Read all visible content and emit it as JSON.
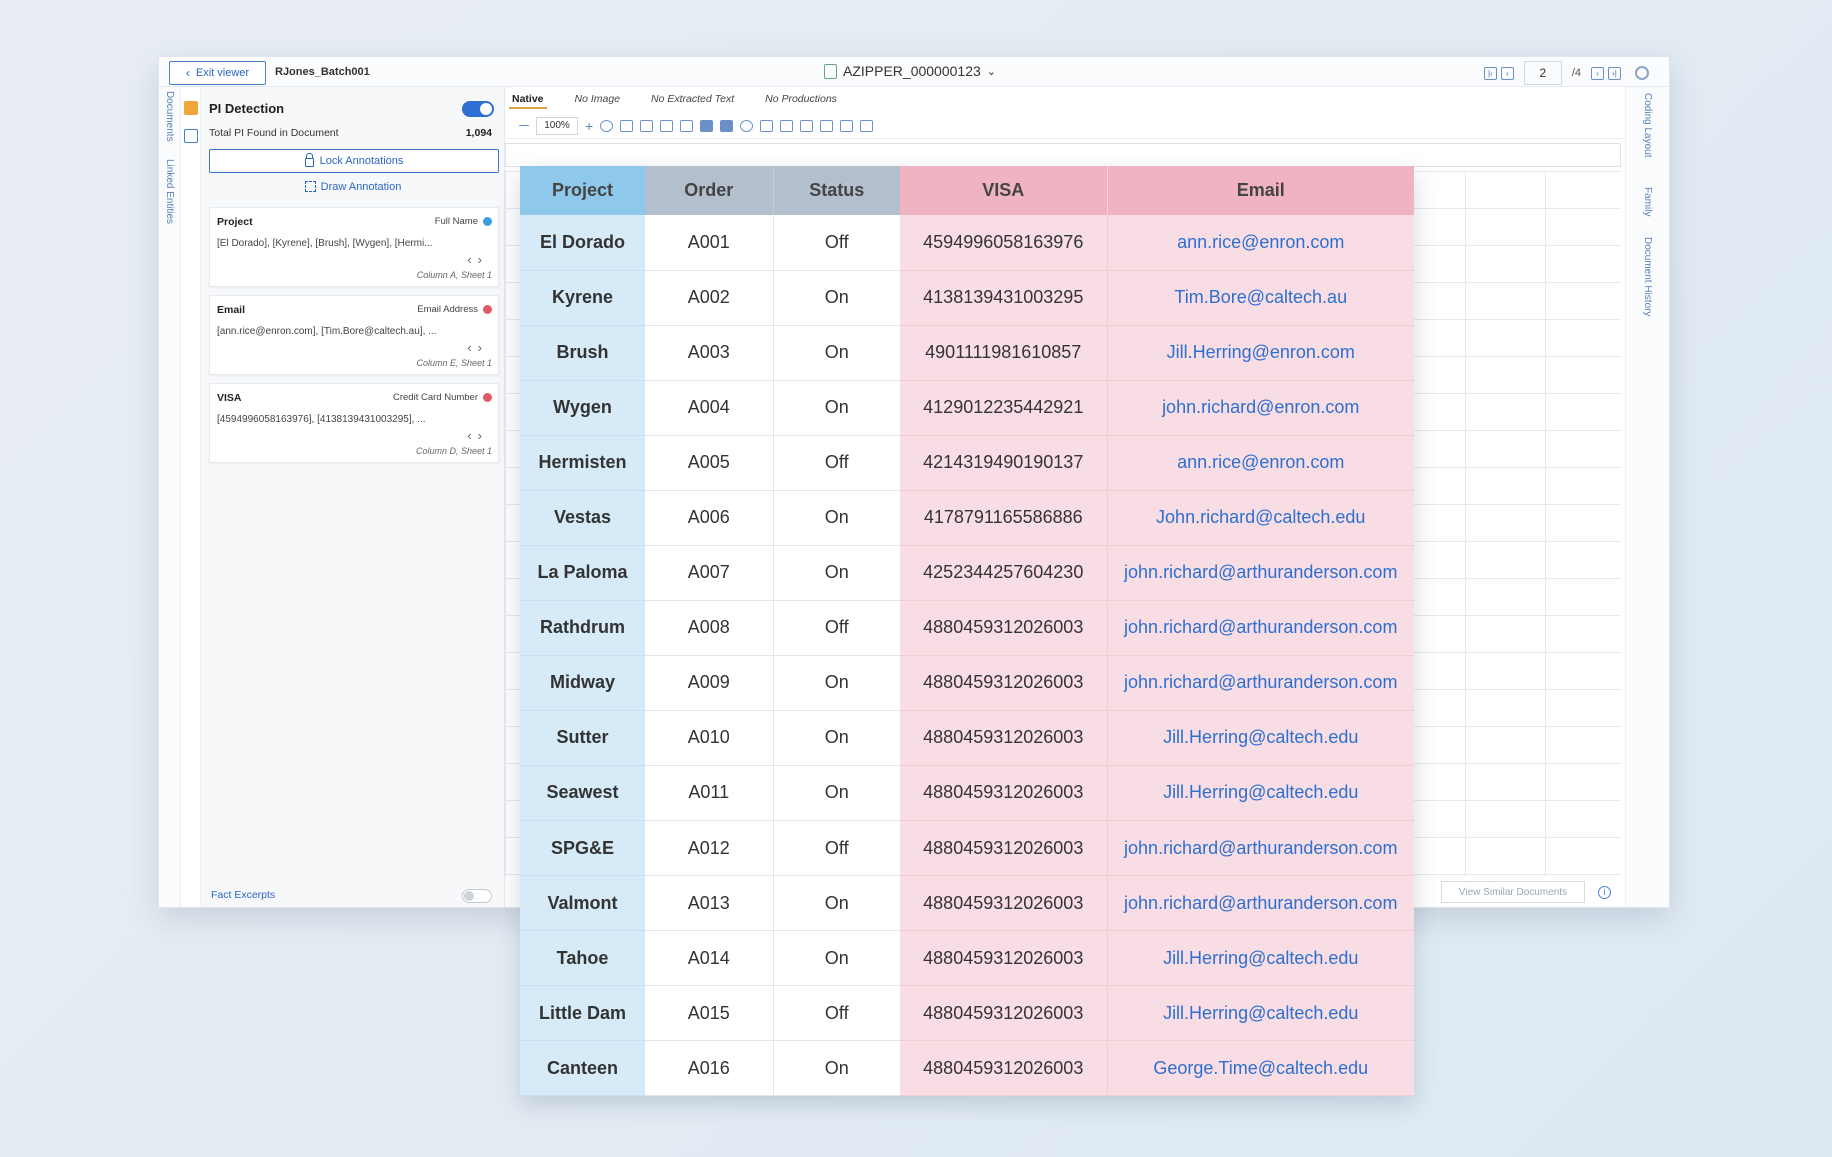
{
  "topbar": {
    "exit_label": "Exit viewer",
    "batch_name": "RJones_Batch001",
    "doc_title": "AZIPPER_000000123",
    "page_current": "2",
    "page_total": "/4"
  },
  "left_rail": {
    "documents": "Documents",
    "linked_entities": "Linked Entities"
  },
  "pi_panel": {
    "title": "PI Detection",
    "enabled": true,
    "total_label": "Total PI Found in Document",
    "total_value": "1,094",
    "lock_label": "Lock Annotations",
    "draw_label": "Draw Annotation",
    "cards": [
      {
        "title": "Project",
        "type": "Full Name",
        "color": "#3d9be0",
        "values": "[El Dorado], [Kyrene], [Brush], [Wygen], [Hermi...",
        "location": "Column A, Sheet 1"
      },
      {
        "title": "Email",
        "type": "Email Address",
        "color": "#e05a6a",
        "values": "[ann.rice@enron.com], [Tim.Bore@caltech.au], ...",
        "location": "Column E, Sheet 1"
      },
      {
        "title": "VISA",
        "type": "Credit Card Number",
        "color": "#e05a6a",
        "values": "[4594996058163976], [4138139431003295], ...",
        "location": "Column D, Sheet 1"
      }
    ],
    "fact_excerpts_label": "Fact Excerpts",
    "fact_excerpts_enabled": false
  },
  "viewer": {
    "tabs": [
      "Native",
      "No Image",
      "No Extracted Text",
      "No Productions"
    ],
    "active_tab": "Native",
    "zoom": "100%",
    "similar_label": "View Similar Documents"
  },
  "right_rail": {
    "coding_layout": "Coding Layout",
    "family": "Family",
    "document_history": "Document History"
  },
  "table": {
    "headers": {
      "project": "Project",
      "order": "Order",
      "status": "Status",
      "visa": "VISA",
      "email": "Email"
    },
    "rows": [
      {
        "project": "El Dorado",
        "order": "A001",
        "status": "Off",
        "visa": "4594996058163976",
        "email": "ann.rice@enron.com"
      },
      {
        "project": "Kyrene",
        "order": "A002",
        "status": "On",
        "visa": "4138139431003295",
        "email": "Tim.Bore@caltech.au"
      },
      {
        "project": "Brush",
        "order": "A003",
        "status": "On",
        "visa": "4901111981610857",
        "email": "Jill.Herring@enron.com"
      },
      {
        "project": "Wygen",
        "order": "A004",
        "status": "On",
        "visa": "4129012235442921",
        "email": "john.richard@enron.com"
      },
      {
        "project": "Hermisten",
        "order": "A005",
        "status": "Off",
        "visa": "4214319490190137",
        "email": "ann.rice@enron.com"
      },
      {
        "project": "Vestas",
        "order": "A006",
        "status": "On",
        "visa": "4178791165586886",
        "email": "John.richard@caltech.edu"
      },
      {
        "project": "La Paloma",
        "order": "A007",
        "status": "On",
        "visa": "4252344257604230",
        "email": "john.richard@arthuranderson.com"
      },
      {
        "project": "Rathdrum",
        "order": "A008",
        "status": "Off",
        "visa": "4880459312026003",
        "email": "john.richard@arthuranderson.com"
      },
      {
        "project": "Midway",
        "order": "A009",
        "status": "On",
        "visa": "4880459312026003",
        "email": "john.richard@arthuranderson.com"
      },
      {
        "project": "Sutter",
        "order": "A010",
        "status": "On",
        "visa": "4880459312026003",
        "email": "Jill.Herring@caltech.edu"
      },
      {
        "project": "Seawest",
        "order": "A011",
        "status": "On",
        "visa": "4880459312026003",
        "email": "Jill.Herring@caltech.edu"
      },
      {
        "project": "SPG&E",
        "order": "A012",
        "status": "Off",
        "visa": "4880459312026003",
        "email": "john.richard@arthuranderson.com"
      },
      {
        "project": "Valmont",
        "order": "A013",
        "status": "On",
        "visa": "4880459312026003",
        "email": "john.richard@arthuranderson.com"
      },
      {
        "project": "Tahoe",
        "order": "A014",
        "status": "On",
        "visa": "4880459312026003",
        "email": "Jill.Herring@caltech.edu"
      },
      {
        "project": "Little Dam",
        "order": "A015",
        "status": "Off",
        "visa": "4880459312026003",
        "email": "Jill.Herring@caltech.edu"
      },
      {
        "project": "Canteen",
        "order": "A016",
        "status": "On",
        "visa": "4880459312026003",
        "email": "George.Time@caltech.edu"
      }
    ]
  }
}
